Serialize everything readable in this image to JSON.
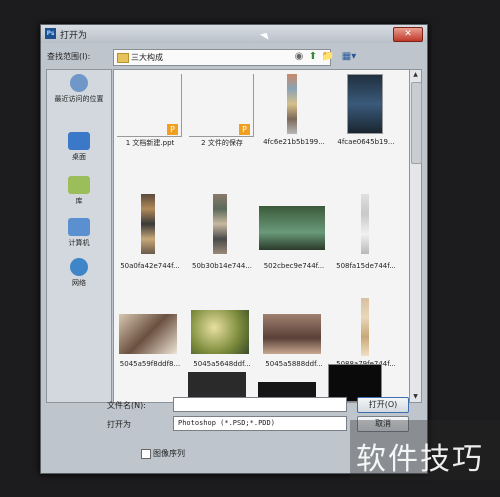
{
  "window": {
    "title": "打开为",
    "app_icon_text": "Ps",
    "close_label": "✕"
  },
  "lookin": {
    "label": "查找范围(I):",
    "value": "三大构成",
    "arrow": "▾"
  },
  "toolbar": {
    "back": "◉",
    "up": "⬆",
    "new_folder": "📁",
    "view": "▦▾"
  },
  "places": [
    {
      "label": "最近访问的位置",
      "icon": "recent-places-icon",
      "color": "#6f98c8"
    },
    {
      "label": "桌面",
      "icon": "desktop-icon",
      "color": "#3c78c8"
    },
    {
      "label": "库",
      "icon": "library-icon",
      "color": "#9bbd5a"
    },
    {
      "label": "计算机",
      "icon": "computer-icon",
      "color": "#5a8fd0"
    },
    {
      "label": "网络",
      "icon": "network-icon",
      "color": "#3f86c8"
    }
  ],
  "files": [
    {
      "name": "1 文档新建.ppt"
    },
    {
      "name": "2 文件的保存"
    },
    {
      "name": "4fc6e21b5b199..."
    },
    {
      "name": "4fcae0645b19..."
    },
    {
      "name": "50a0fa42e744f..."
    },
    {
      "name": "50b30b14e744..."
    },
    {
      "name": "502cbec9e744f..."
    },
    {
      "name": "508fa15de744f..."
    },
    {
      "name": "5045a59f8ddf8..."
    },
    {
      "name": "5045a5648ddf..."
    },
    {
      "name": "5045a5888ddf..."
    },
    {
      "name": "5088a79fe744f..."
    }
  ],
  "filename": {
    "label": "文件名(N):",
    "value": ""
  },
  "filetype": {
    "label": "打开为",
    "value": "Photoshop (*.PSD;*.PDD)"
  },
  "buttons": {
    "open": "打开(O)",
    "cancel": "取消"
  },
  "image_sequence": {
    "label": "图像序列",
    "checked": false
  },
  "scroll": {
    "up": "▲",
    "down": "▼"
  },
  "watermark": {
    "text": "软件技巧"
  }
}
